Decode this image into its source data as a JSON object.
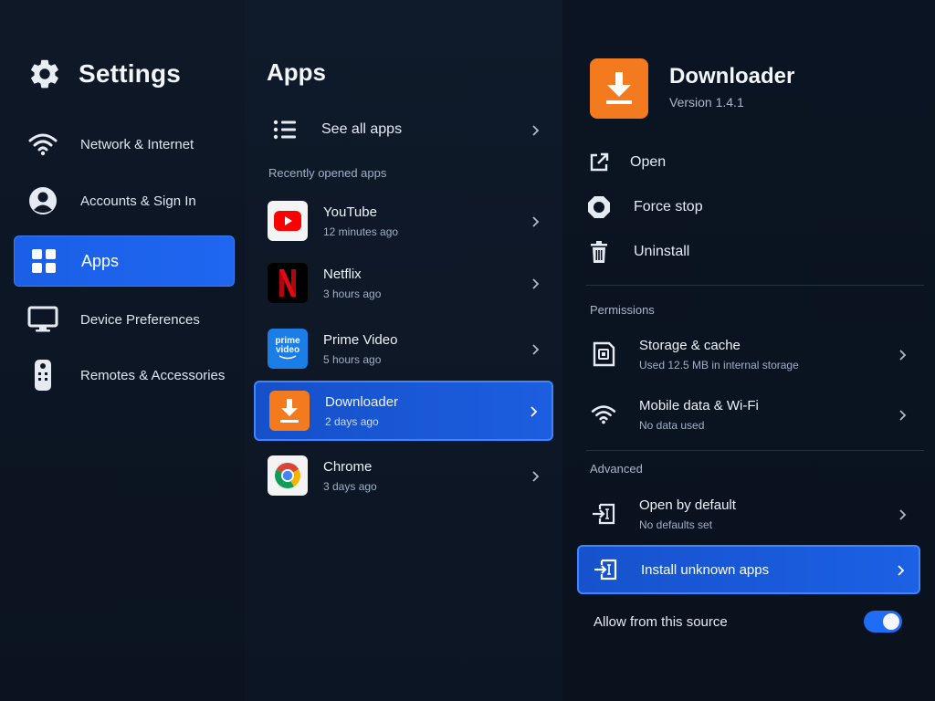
{
  "settings": {
    "title": "Settings",
    "nav": [
      {
        "label": "Network & Internet",
        "icon": "wifi-icon"
      },
      {
        "label": "Accounts & Sign In",
        "icon": "account-icon"
      },
      {
        "label": "Apps",
        "icon": "apps-grid-icon",
        "active": true
      },
      {
        "label": "Device Preferences",
        "icon": "monitor-icon"
      },
      {
        "label": "Remotes & Accessories",
        "icon": "remote-icon"
      }
    ]
  },
  "apps": {
    "title": "Apps",
    "see_all_label": "See all apps",
    "recent_label": "Recently opened apps",
    "items": [
      {
        "name": "YouTube",
        "sub": "12 minutes ago",
        "icon": "youtube-icon"
      },
      {
        "name": "Netflix",
        "sub": "3 hours ago",
        "icon": "netflix-icon"
      },
      {
        "name": "Prime Video",
        "sub": "5 hours ago",
        "icon": "prime-video-icon",
        "icon_text_1": "prime",
        "icon_text_2": "video"
      },
      {
        "name": "Downloader",
        "sub": "2 days ago",
        "icon": "downloader-icon",
        "active": true
      },
      {
        "name": "Chrome",
        "sub": "3 days ago",
        "icon": "chrome-icon"
      }
    ]
  },
  "detail": {
    "app_name": "Downloader",
    "version": "Version 1.4.1",
    "actions": [
      {
        "label": "Open",
        "icon": "open-external-icon"
      },
      {
        "label": "Force stop",
        "icon": "stop-icon"
      },
      {
        "label": "Uninstall",
        "icon": "trash-icon"
      }
    ],
    "permissions_label": "Permissions",
    "permissions": [
      {
        "name": "Storage & cache",
        "sub": "Used 12.5 MB in internal storage",
        "icon": "storage-icon"
      },
      {
        "name": "Mobile data & Wi-Fi",
        "sub": "No data used",
        "icon": "wifi-icon"
      }
    ],
    "advanced_label": "Advanced",
    "advanced": [
      {
        "name": "Open by default",
        "sub": "No defaults set",
        "icon": "open-default-icon"
      },
      {
        "name": "Install unknown apps",
        "sub": "",
        "icon": "install-icon",
        "active": true
      }
    ],
    "toggle_label": "Allow from this source",
    "toggle_on": true
  },
  "colors": {
    "accent": "#1f66f0",
    "downloader_orange": "#f47a20",
    "background": "#0c1422"
  }
}
